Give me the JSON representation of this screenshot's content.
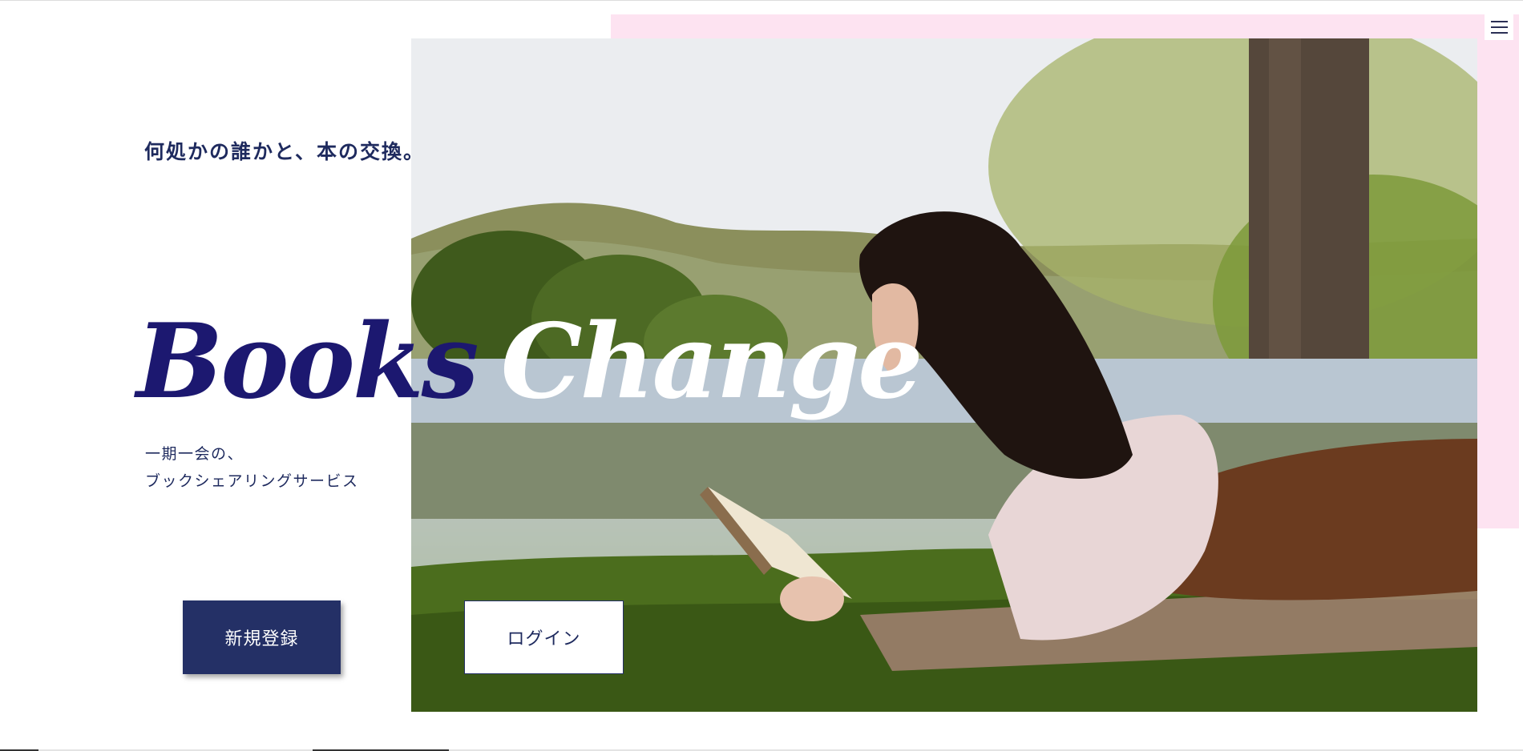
{
  "hero": {
    "tagline": "何処かの誰かと、本の交換。",
    "logo": {
      "word1": "Books",
      "word2": "Change"
    },
    "subcopy": [
      "一期一会の、",
      "ブックシェアリングサービス"
    ],
    "photo": "woman-reading-book-on-grass-by-lake"
  },
  "actions": {
    "signup_label": "新規登録",
    "login_label": "ログイン"
  },
  "header": {
    "menu_icon": "hamburger-menu-icon"
  },
  "colors": {
    "navy": "#243066",
    "logo_navy": "#1c1870",
    "pink_accent": "#fde3f1",
    "background": "#ffffff"
  }
}
